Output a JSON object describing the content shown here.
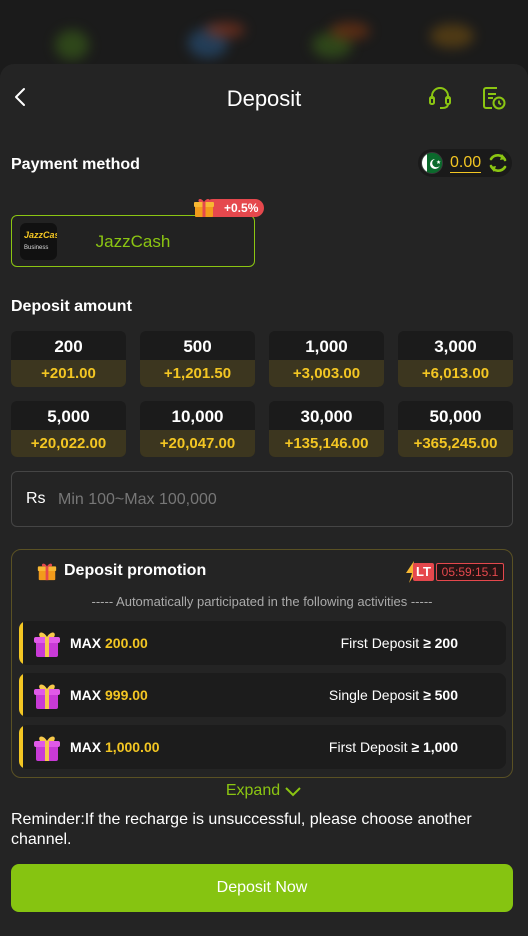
{
  "header": {
    "title": "Deposit"
  },
  "payment": {
    "section_title": "Payment method",
    "balance": "0.00",
    "methods": [
      {
        "name": "JazzCash",
        "bonus": "+0.5%",
        "logo_top": "JazzCash",
        "logo_bottom": "Business"
      }
    ]
  },
  "deposit": {
    "section_title": "Deposit amount",
    "amounts": [
      {
        "value": "200",
        "bonus": "+201.00"
      },
      {
        "value": "500",
        "bonus": "+1,201.50"
      },
      {
        "value": "1,000",
        "bonus": "+3,003.00"
      },
      {
        "value": "3,000",
        "bonus": "+6,013.00"
      },
      {
        "value": "5,000",
        "bonus": "+20,022.00"
      },
      {
        "value": "10,000",
        "bonus": "+20,047.00"
      },
      {
        "value": "30,000",
        "bonus": "+135,146.00"
      },
      {
        "value": "50,000",
        "bonus": "+365,245.00"
      }
    ],
    "currency": "Rs",
    "input_placeholder": "Min 100~Max 100,000"
  },
  "promotion": {
    "title": "Deposit promotion",
    "lt_label": "LT",
    "timer": "05:59:15.1",
    "subtitle": "----- Automatically participated in the following activities -----",
    "max_label": "MAX",
    "rows": [
      {
        "max": "200.00",
        "condition": "First Deposit",
        "op": "≥",
        "threshold": "200"
      },
      {
        "max": "999.00",
        "condition": "Single Deposit",
        "op": "≥",
        "threshold": "500"
      },
      {
        "max": "1,000.00",
        "condition": "First Deposit",
        "op": "≥",
        "threshold": "1,000"
      }
    ]
  },
  "expand_label": "Expand",
  "reminder": "Reminder:If the recharge is unsuccessful, please choose another channel.",
  "deposit_button": "Deposit Now",
  "colors": {
    "accent": "#86c411",
    "gold": "#f3c623",
    "red": "#e5484d",
    "background": "#242424"
  }
}
